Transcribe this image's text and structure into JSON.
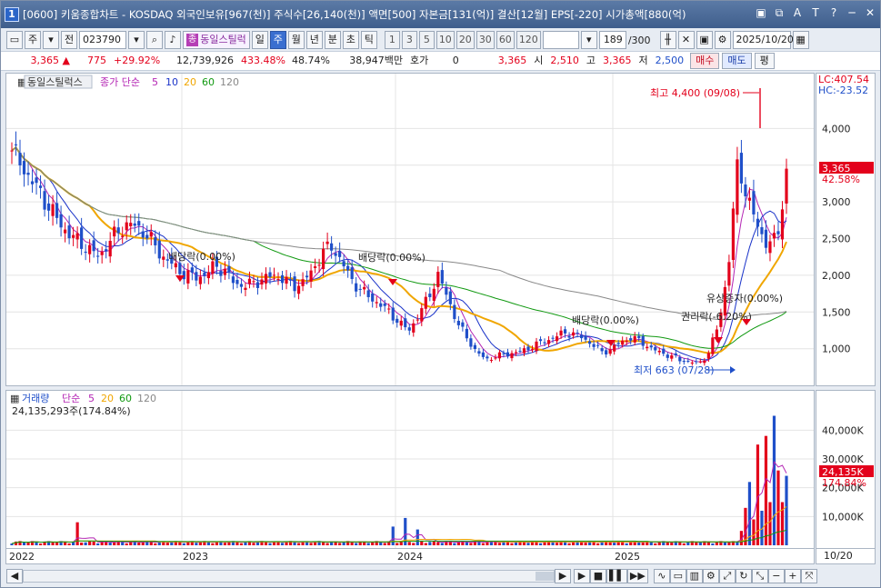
{
  "window": {
    "app_number": "1",
    "title": "[0600] 키움종합차트 - KOSDAQ 외국인보유[967(천)] 주식수[26,140(천)] 액면[500] 자본금[131(억)] 결산[12월] EPS[-220] 시가총액[880(억)",
    "buttons": [
      "▣",
      "⧉",
      "A",
      "T",
      "?",
      "─",
      "✕"
    ]
  },
  "toolbar1": {
    "mode_label": "주",
    "prev_label": "전",
    "code": "023790",
    "stock_badge": "종",
    "stock_name": "동일스틸럭",
    "period_tabs": [
      "일",
      "주",
      "월",
      "년",
      "분",
      "초",
      "틱"
    ],
    "active_period": "주",
    "minute_options": [
      "1",
      "3",
      "5",
      "10",
      "20",
      "30",
      "60",
      "120"
    ],
    "count": "189",
    "count_total": "/300",
    "date": "2025/10/20"
  },
  "quote": {
    "price": "3,365",
    "change": "775",
    "change_pct": "+29.92%",
    "volume": "12,739,926",
    "volume_ratio": "433.48%",
    "turnover": "48.74%",
    "amount": "38,947백만",
    "hoga_label": "호가",
    "hoga_value": "0",
    "hoga_price": "3,365",
    "open_label": "시",
    "open": "2,510",
    "high_label": "고",
    "high": "3,365",
    "low_label": "저",
    "low": "2,500",
    "buy_label": "매수",
    "sell_label": "매도",
    "eval_label": "평"
  },
  "price_panel": {
    "stock_label": "동일스틸럭스",
    "ma_label": "종가 단순",
    "ma_periods": [
      "5",
      "10",
      "20",
      "60",
      "120"
    ],
    "ma_colors": [
      "#b425b4",
      "#1a33c9",
      "#f0a600",
      "#119911",
      "#888888"
    ],
    "lc_label": "LC:407.54",
    "hc_label": "HC:-23.52",
    "last_price_tag": "3,365",
    "last_pct_tag": "42.58%",
    "annotations": {
      "high": "최고 4,400 (09/08)",
      "low": "최저 663 (07/28)",
      "div1": "배당락(0.00%)",
      "div2": "배당락(0.00%)",
      "div3": "배당락(0.00%)",
      "rights": "권리락(-6.20%)",
      "capital": "유상증자(0.00%)"
    }
  },
  "volume_panel": {
    "label": "거래량",
    "ma_label": "단순",
    "ma_periods": [
      "5",
      "20",
      "60",
      "120"
    ],
    "value_label": "24,135,293주(174.84%)",
    "last_tag": "24,135K",
    "last_pct": "174.84%"
  },
  "date_axis": {
    "labels": [
      "2022",
      "2023",
      "2024",
      "2025"
    ],
    "right_label": "10/20"
  },
  "chart_data": {
    "type": "candlestick",
    "y_ticks": [
      "4,000",
      "3,500",
      "3,000",
      "2,500",
      "2,000",
      "1,500",
      "1,000"
    ],
    "ylim": [
      663,
      4400
    ],
    "vol_ticks": [
      "40,000K",
      "30,000K",
      "20,000K",
      "10,000K"
    ],
    "close_series": [
      3700,
      3500,
      3300,
      3100,
      2900,
      2700,
      2550,
      2450,
      2350,
      2250,
      2450,
      2600,
      2700,
      2650,
      2550,
      2350,
      2200,
      2100,
      2000,
      1980,
      2000,
      2150,
      2050,
      1900,
      1850,
      1900,
      1950,
      2000,
      1950,
      1850,
      1900,
      2050,
      2300,
      2400,
      2200,
      1950,
      1800,
      1700,
      1600,
      1500,
      1350,
      1250,
      1450,
      1700,
      2000,
      1700,
      1350,
      1150,
      950,
      850,
      900,
      920,
      950,
      980,
      1050,
      1100,
      1150,
      1220,
      1200,
      1150,
      1050,
      950,
      1000,
      1100,
      1150,
      1100,
      1000,
      950,
      900,
      850,
      820,
      800,
      950,
      1350,
      2100,
      3600,
      3000,
      2700,
      2400,
      2500,
      3365
    ]
  }
}
